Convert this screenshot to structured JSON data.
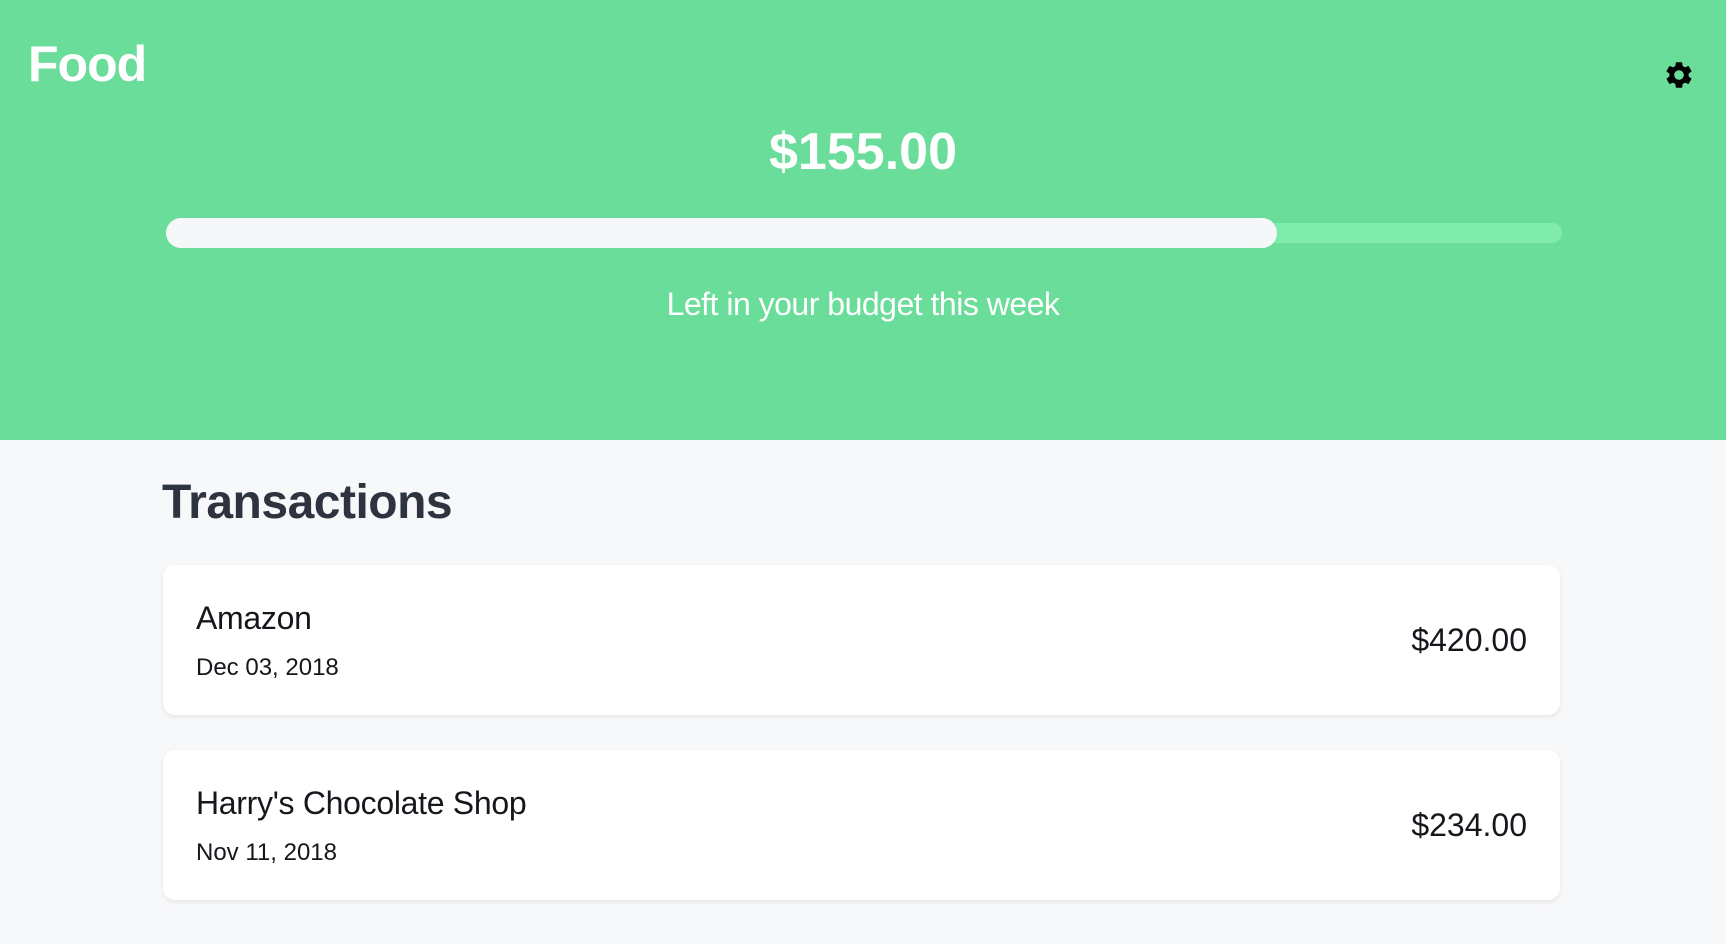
{
  "header": {
    "title": "Food",
    "settings_icon": "gear-icon",
    "remaining_amount": "$155.00",
    "budget_remaining_fraction": 0.796,
    "caption": "Left in your budget this week",
    "background_color": "#69dd99"
  },
  "transactions": {
    "title": "Transactions",
    "items": [
      {
        "merchant": "Amazon",
        "date": "Dec 03, 2018",
        "amount": "$420.00"
      },
      {
        "merchant": "Harry's Chocolate Shop",
        "date": "Nov 11, 2018",
        "amount": "$234.00"
      }
    ]
  }
}
